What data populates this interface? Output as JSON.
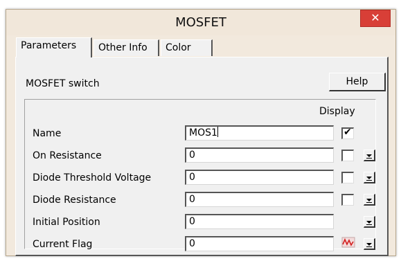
{
  "window": {
    "title": "MOSFET",
    "close_glyph": "✕"
  },
  "tabs": [
    {
      "label": "Parameters",
      "active": true
    },
    {
      "label": "Other Info",
      "active": false
    },
    {
      "label": "Color",
      "active": false
    }
  ],
  "panel": {
    "caption": "MOSFET switch",
    "help_label": "Help",
    "display_header": "Display"
  },
  "params": [
    {
      "label": "Name",
      "value": "MOS1",
      "display": "checked"
    },
    {
      "label": "On Resistance",
      "value": "0",
      "display": "unchecked"
    },
    {
      "label": "Diode Threshold Voltage",
      "value": "0",
      "display": "unchecked"
    },
    {
      "label": "Diode Resistance",
      "value": "0",
      "display": "unchecked"
    },
    {
      "label": "Initial Position",
      "value": "0",
      "display": "none"
    },
    {
      "label": "Current Flag",
      "value": "0",
      "display": "flag-icon"
    }
  ]
}
